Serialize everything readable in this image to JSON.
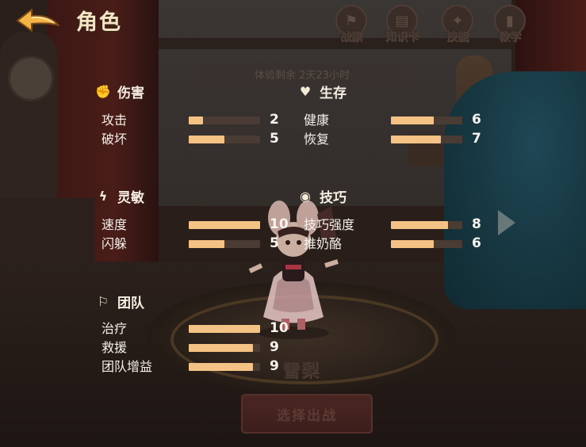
{
  "header": {
    "title": "角色",
    "tabs": [
      {
        "label": "战旗",
        "icon": "flag-icon"
      },
      {
        "label": "知识卡",
        "icon": "card-icon"
      },
      {
        "label": "技能",
        "icon": "skill-icon"
      },
      {
        "label": "教学",
        "icon": "book-icon"
      }
    ]
  },
  "trial": {
    "text": "体验剩余 2天23小时"
  },
  "stats": {
    "max": 10,
    "damage": {
      "title": "伤害",
      "icon": "fist-icon",
      "rows": [
        {
          "label": "攻击",
          "value": 2
        },
        {
          "label": "破坏",
          "value": 5
        }
      ]
    },
    "survival": {
      "title": "生存",
      "icon": "heart-plus-icon",
      "rows": [
        {
          "label": "健康",
          "value": 6
        },
        {
          "label": "恢复",
          "value": 7
        }
      ]
    },
    "agility": {
      "title": "灵敏",
      "icon": "lightning-icon",
      "rows": [
        {
          "label": "速度",
          "value": 10
        },
        {
          "label": "闪躲",
          "value": 5
        }
      ]
    },
    "skill": {
      "title": "技巧",
      "icon": "target-icon",
      "rows": [
        {
          "label": "技巧强度",
          "value": 8
        },
        {
          "label": "推奶酪",
          "value": 6
        }
      ]
    },
    "team": {
      "title": "团队",
      "icon": "flag-wave-icon",
      "rows": [
        {
          "label": "治疗",
          "value": 10
        },
        {
          "label": "救援",
          "value": 9
        },
        {
          "label": "团队增益",
          "value": 9
        }
      ]
    }
  },
  "character": {
    "name": "雪梨"
  },
  "actions": {
    "battle": "选择出战"
  },
  "colors": {
    "bar_fill": "#f4c285",
    "bar_track": "#4a3c35",
    "title": "#f6e6c6"
  }
}
